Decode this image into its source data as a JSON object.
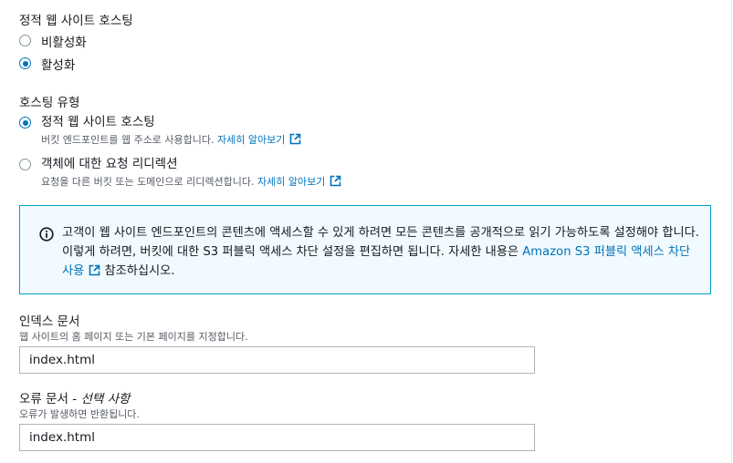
{
  "hosting": {
    "title": "정적 웹 사이트 호스팅",
    "options": [
      {
        "label": "비활성화",
        "selected": false
      },
      {
        "label": "활성화",
        "selected": true
      }
    ]
  },
  "hosting_type": {
    "title": "호스팅 유형",
    "options": [
      {
        "label": "정적 웹 사이트 호스팅",
        "description": "버킷 엔드포인트를 웹 주소로 사용합니다.",
        "link": "자세히 알아보기",
        "selected": true
      },
      {
        "label": "객체에 대한 요청 리디렉션",
        "description": "요청을 다른 버킷 또는 도메인으로 리디렉션합니다.",
        "link": "자세히 알아보기",
        "selected": false
      }
    ]
  },
  "info": {
    "text_before_link": "고객이 웹 사이트 엔드포인트의 콘텐츠에 액세스할 수 있게 하려면 모든 콘텐츠를 공개적으로 읽기 가능하도록 설정해야 합니다. 이렇게 하려면, 버킷에 대한 S3 퍼블릭 액세스 차단 설정을 편집하면 됩니다. 자세한 내용은 ",
    "link": "Amazon S3 퍼블릭 액세스 차단 사용",
    "text_after_link": " 참조하십시오."
  },
  "index_document": {
    "label": "인덱스 문서",
    "description": "웹 사이트의 홈 페이지 또는 기본 페이지를 지정합니다.",
    "value": "index.html"
  },
  "error_document": {
    "label": "오류 문서",
    "optional": "선택 사항",
    "description": "오류가 발생하면 반환됩니다.",
    "value": "index.html"
  },
  "colors": {
    "accent": "#0073bb",
    "info_border": "#00a1c9",
    "info_bg": "#f1faff"
  }
}
